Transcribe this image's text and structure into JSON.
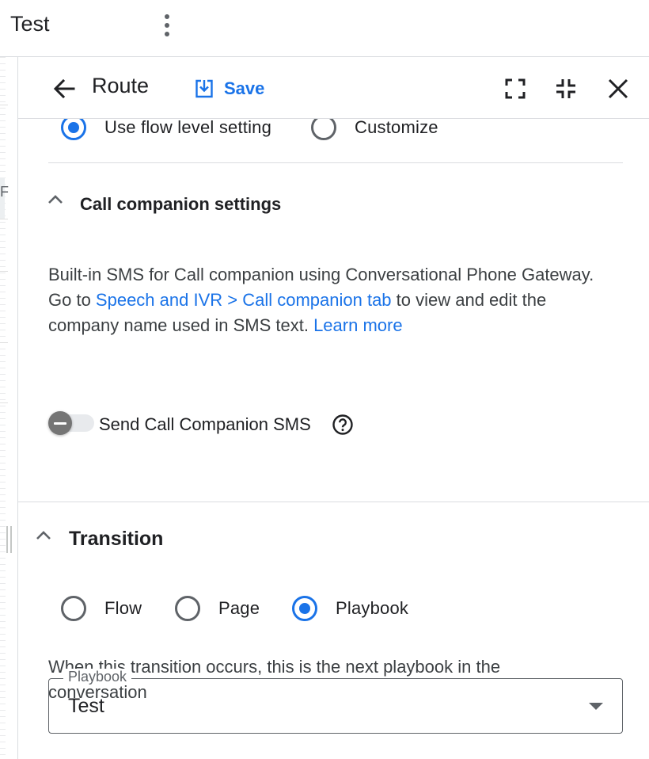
{
  "topbar": {
    "title": "Test",
    "menu_icon": "more-vert-icon"
  },
  "left_strip": {
    "clipped_text": "F"
  },
  "panel": {
    "header": {
      "back_icon": "arrow-back-icon",
      "title": "Route",
      "save_label": "Save",
      "save_icon": "save-download-icon",
      "fullscreen_icon": "fullscreen-icon",
      "exit_fullscreen_icon": "fullscreen-exit-icon",
      "close_icon": "close-icon"
    },
    "level_setting": {
      "options": [
        {
          "label": "Use flow level setting",
          "selected": true
        },
        {
          "label": "Customize",
          "selected": false
        }
      ]
    },
    "call_companion": {
      "title": "Call companion settings",
      "expanded": true,
      "text_1": "Built-in SMS for Call companion using Conversational Phone Gateway.",
      "text_2_prefix": "Go to ",
      "link_1": "Speech and IVR > Call companion tab",
      "text_2_suffix": " to view and edit the",
      "text_3": "company name used in SMS text. ",
      "link_2": "Learn more",
      "toggle_label": "Send Call Companion SMS",
      "toggle_on": false,
      "help_icon": "help-circle-icon"
    },
    "transition": {
      "title": "Transition",
      "expanded": true,
      "options": [
        {
          "label": "Flow",
          "selected": false
        },
        {
          "label": "Page",
          "selected": false
        },
        {
          "label": "Playbook",
          "selected": true
        }
      ],
      "description": "When this transition occurs, this is the next playbook in the conversation",
      "playbook_field": {
        "label": "Playbook",
        "value": "Test"
      }
    }
  },
  "colors": {
    "accent": "#1a73e8",
    "text": "#202124",
    "secondary_text": "#5f6368",
    "divider": "#dadce0"
  }
}
